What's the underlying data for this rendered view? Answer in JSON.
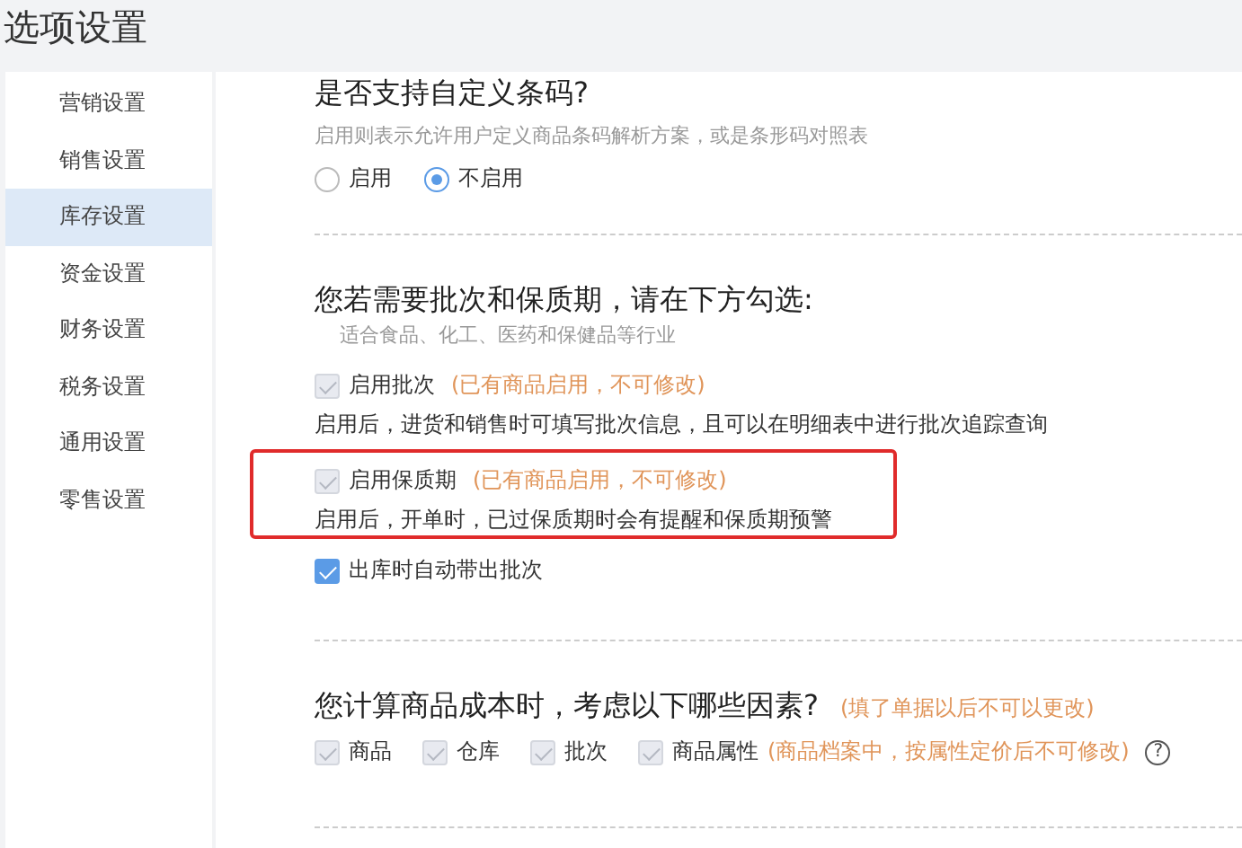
{
  "window": {
    "title": "选项设置"
  },
  "sidebar": {
    "items": [
      {
        "label": "营销设置",
        "selected": false
      },
      {
        "label": "销售设置",
        "selected": false
      },
      {
        "label": "库存设置",
        "selected": true
      },
      {
        "label": "资金设置",
        "selected": false
      },
      {
        "label": "财务设置",
        "selected": false
      },
      {
        "label": "税务设置",
        "selected": false
      },
      {
        "label": "通用设置",
        "selected": false
      },
      {
        "label": "零售设置",
        "selected": false
      }
    ]
  },
  "barcode": {
    "title": "是否支持自定义条码?",
    "hint": "启用则表示允许用户定义商品条码解析方案，或是条形码对照表",
    "options": [
      {
        "label": "启用",
        "selected": false
      },
      {
        "label": "不启用",
        "selected": true
      }
    ]
  },
  "batch": {
    "title": "您若需要批次和保质期，请在下方勾选:",
    "hint": "适合食品、化工、医药和保健品等行业",
    "items": [
      {
        "label": "启用批次",
        "note": "(已有商品启用，不可修改)",
        "description": "启用后，进货和销售时可填写批次信息，且可以在明细表中进行批次追踪查询",
        "checked": true,
        "disabled": true,
        "highlighted": false
      },
      {
        "label": "启用保质期",
        "note": "(已有商品启用，不可修改)",
        "description": "启用后，开单时，已过保质期时会有提醒和保质期预警",
        "checked": true,
        "disabled": true,
        "highlighted": true
      },
      {
        "label": "出库时自动带出批次",
        "checked": true,
        "disabled": false,
        "highlighted": false
      }
    ]
  },
  "cost": {
    "title": "您计算商品成本时，考虑以下哪些因素?",
    "note": "(填了单据以后不可以更改)",
    "factors": [
      {
        "label": "商品",
        "checked": true,
        "disabled": true
      },
      {
        "label": "仓库",
        "checked": true,
        "disabled": true
      },
      {
        "label": "批次",
        "checked": true,
        "disabled": true
      },
      {
        "label": "商品属性",
        "note": "(商品档案中，按属性定价后不可修改)",
        "checked": true,
        "disabled": true
      }
    ],
    "help": "?"
  }
}
